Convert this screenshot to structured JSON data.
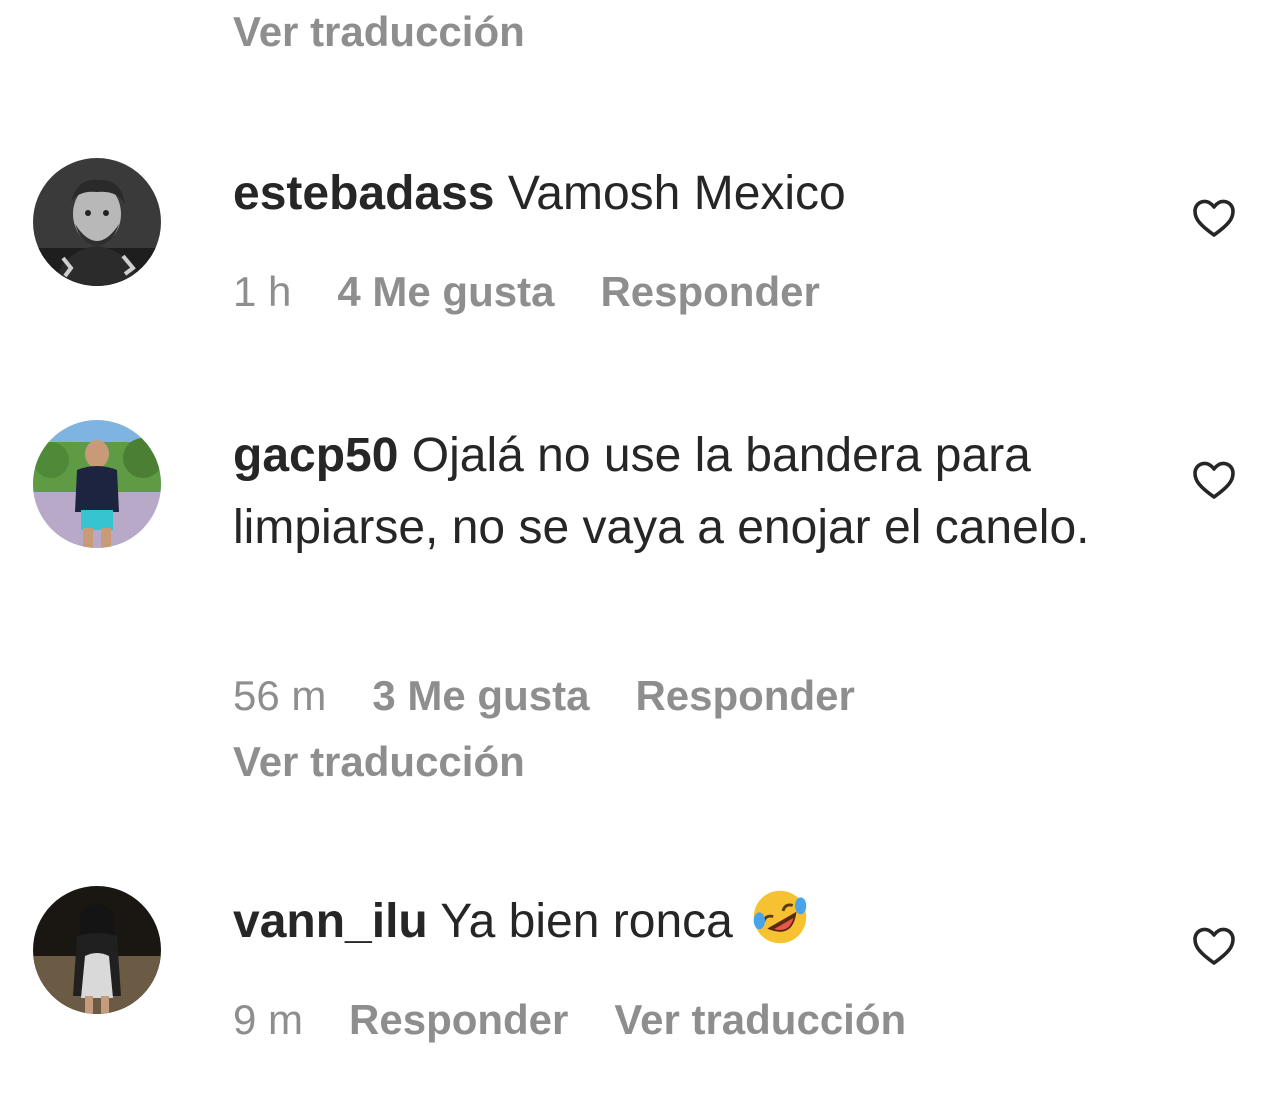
{
  "top": {
    "translate_label": "Ver traducción"
  },
  "comments": [
    {
      "username": "estebadass",
      "text": "Vamosh Mexico",
      "time": "1 h",
      "likes": "4 Me gusta",
      "reply_label": "Responder",
      "heart_icon": "heart-outline-icon"
    },
    {
      "username": "gacp50",
      "text": "Ojalá no use la bandera para limpiarse, no se vaya a enojar el canelo.",
      "time": "56 m",
      "likes": "3 Me gusta",
      "reply_label": "Responder",
      "translate_label": "Ver traducción",
      "heart_icon": "heart-outline-icon"
    },
    {
      "username": "vann_ilu",
      "text": "Ya bien ronca",
      "emoji": "rolling-on-floor-laughing",
      "time": "9 m",
      "reply_label": "Responder",
      "translate_label": "Ver traducción",
      "heart_icon": "heart-outline-icon"
    }
  ],
  "colors": {
    "primary_text": "#262626",
    "secondary_text": "#8e8e8e",
    "background": "#ffffff"
  }
}
